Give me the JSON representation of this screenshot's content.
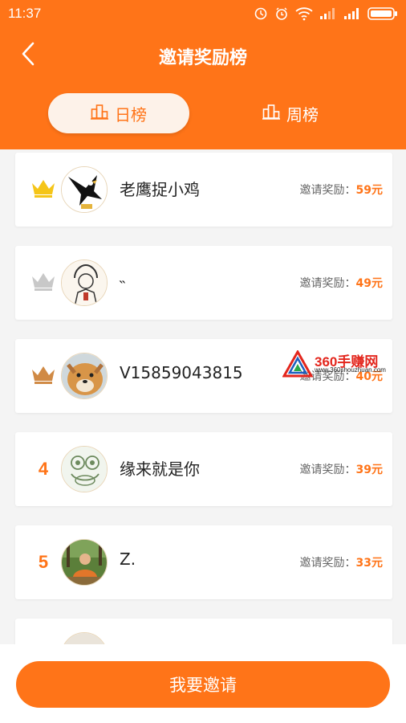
{
  "status_bar": {
    "time": "11:37"
  },
  "header": {
    "title": "邀请奖励榜"
  },
  "tabs": [
    {
      "label": "日榜",
      "active": true
    },
    {
      "label": "周榜",
      "active": false
    }
  ],
  "reward_label": "邀请奖励：",
  "ranking": [
    {
      "rank": "1",
      "rank_icon": "crown-gold-icon",
      "avatar": "eagle-avatar",
      "name": "老鹰捉小鸡",
      "reward_label": "邀请奖励：",
      "reward_amount": "59元"
    },
    {
      "rank": "2",
      "rank_icon": "crown-silver-icon",
      "avatar": "sketch-avatar",
      "name": "˵",
      "reward_label": "邀请奖励：",
      "reward_amount": "49元"
    },
    {
      "rank": "3",
      "rank_icon": "crown-bronze-icon",
      "avatar": "dog-avatar",
      "name": "V15859043815",
      "reward_label": "邀请奖励：",
      "reward_amount": "40元"
    },
    {
      "rank": "4",
      "avatar": "frog-avatar",
      "name": "缘来就是你",
      "reward_label": "邀请奖励：",
      "reward_amount": "39元"
    },
    {
      "rank": "5",
      "avatar": "monk-avatar",
      "name": "Z.",
      "reward_label": "邀请奖励：",
      "reward_amount": "33元"
    },
    {
      "rank": "",
      "avatar": "person-avatar",
      "name": "",
      "reward_label": "",
      "reward_amount": ""
    }
  ],
  "watermark": {
    "title": "360手赚网",
    "url": "www.360shouzhuan.com"
  },
  "footer": {
    "invite_button": "我要邀请"
  },
  "colors": {
    "brand": "#ff7418",
    "crown_gold": "#f5c518",
    "crown_silver": "#c8c8c8",
    "crown_bronze": "#d08a45"
  }
}
